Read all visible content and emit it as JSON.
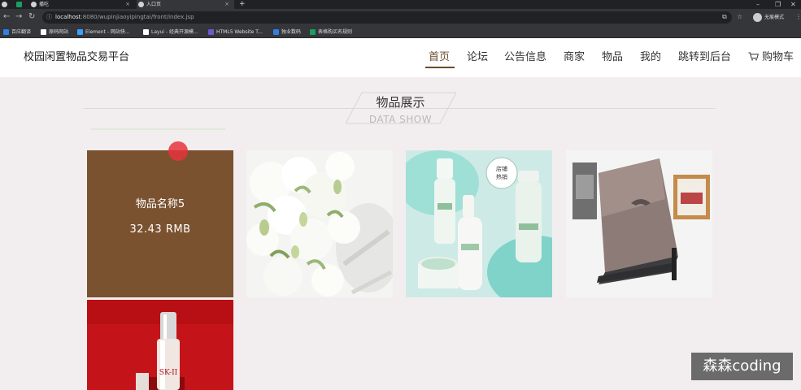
{
  "browser": {
    "tabs": [
      {
        "title": "",
        "active": false
      },
      {
        "title": "",
        "active": false
      },
      {
        "title": "播吃",
        "active": false
      },
      {
        "title": "入口页",
        "active": true
      }
    ],
    "new_tab_label": "+",
    "url_host": "localhost",
    "url_path": ":8080/wupinjiaoyipingtai/front/index.jsp",
    "incognito_label": "无痕模式",
    "bookmarks": [
      {
        "label": "百应翻译",
        "color": "#2f7fe8"
      },
      {
        "label": "原码网站",
        "color": "#ffffff"
      },
      {
        "label": "Element - 网站快...",
        "color": "#409eff"
      },
      {
        "label": "Layui - 经典开源模...",
        "color": "#ffffff"
      },
      {
        "label": "HTML5 Website T...",
        "color": "#6a5acd"
      },
      {
        "label": "独业数码",
        "color": "#2f7fe8"
      },
      {
        "label": "表格购买名规则",
        "color": "#1a9e5f"
      }
    ]
  },
  "site": {
    "logo": "校园闲置物品交易平台",
    "nav": [
      {
        "label": "首页",
        "active": true
      },
      {
        "label": "论坛",
        "active": false
      },
      {
        "label": "公告信息",
        "active": false
      },
      {
        "label": "商家",
        "active": false
      },
      {
        "label": "物品",
        "active": false
      },
      {
        "label": "我的",
        "active": false
      },
      {
        "label": "跳转到后台",
        "active": false
      },
      {
        "label": "购物车",
        "active": false
      }
    ]
  },
  "section": {
    "title": "物品展示",
    "subtitle": "DATA SHOW"
  },
  "products": [
    {
      "name": "物品名称5",
      "price": "32.43 RMB",
      "image": "dark-wood"
    },
    {
      "image": "white-flowers"
    },
    {
      "image": "green-cosmetics",
      "badge_line1": "店铺",
      "badge_line2": "热销"
    },
    {
      "image": "laptop"
    },
    {
      "image": "skii-bottle",
      "brand": "SK-II"
    }
  ],
  "watermark": "森森coding"
}
